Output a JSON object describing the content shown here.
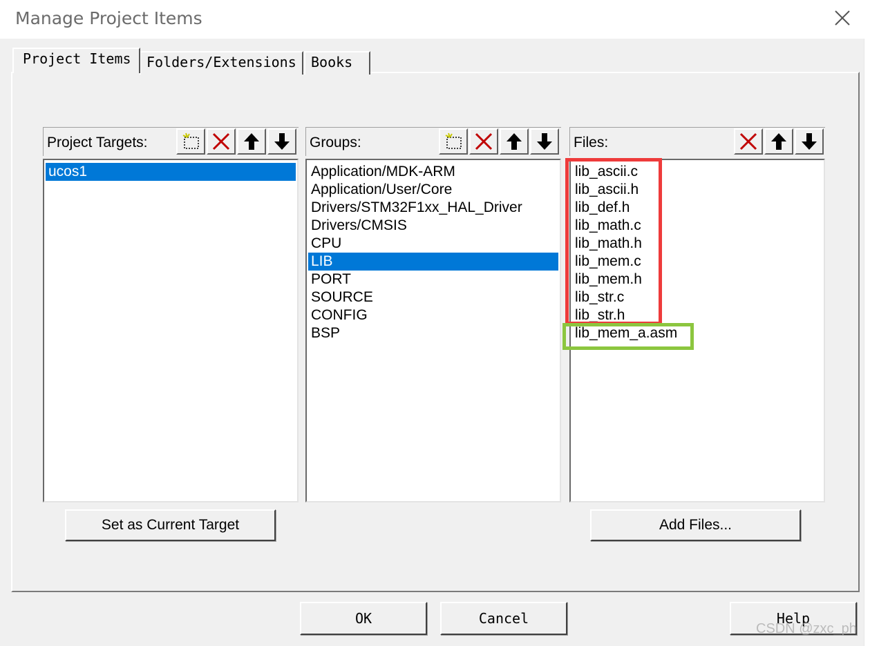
{
  "window": {
    "title": "Manage Project Items"
  },
  "tabs": [
    {
      "label": "Project Items",
      "active": true
    },
    {
      "label": "Folders/Extensions",
      "active": false
    },
    {
      "label": "Books",
      "active": false
    }
  ],
  "targets": {
    "label": "Project Targets:",
    "items": [
      "ucos1"
    ],
    "selected_index": 0,
    "set_current_label": "Set as Current Target"
  },
  "groups": {
    "label": "Groups:",
    "items": [
      "Application/MDK-ARM",
      "Application/User/Core",
      "Drivers/STM32F1xx_HAL_Driver",
      "Drivers/CMSIS",
      "CPU",
      "LIB",
      "PORT",
      "SOURCE",
      "CONFIG",
      "BSP"
    ],
    "selected_index": 5
  },
  "files": {
    "label": "Files:",
    "items": [
      "lib_ascii.c",
      "lib_ascii.h",
      "lib_def.h",
      "lib_math.c",
      "lib_math.h",
      "lib_mem.c",
      "lib_mem.h",
      "lib_str.c",
      "lib_str.h",
      "lib_mem_a.asm"
    ],
    "add_files_label": "Add Files..."
  },
  "icons": {
    "new": "new-item-icon",
    "delete": "delete-x-icon",
    "move_up": "arrow-up-icon",
    "move_down": "arrow-down-icon"
  },
  "dialog_buttons": {
    "ok": "OK",
    "cancel": "Cancel",
    "help": "Help"
  },
  "annotations": {
    "red_box_color": "#ee3b3b",
    "green_box_color": "#8cc63f"
  },
  "watermark": "CSDN @zxc_ph"
}
